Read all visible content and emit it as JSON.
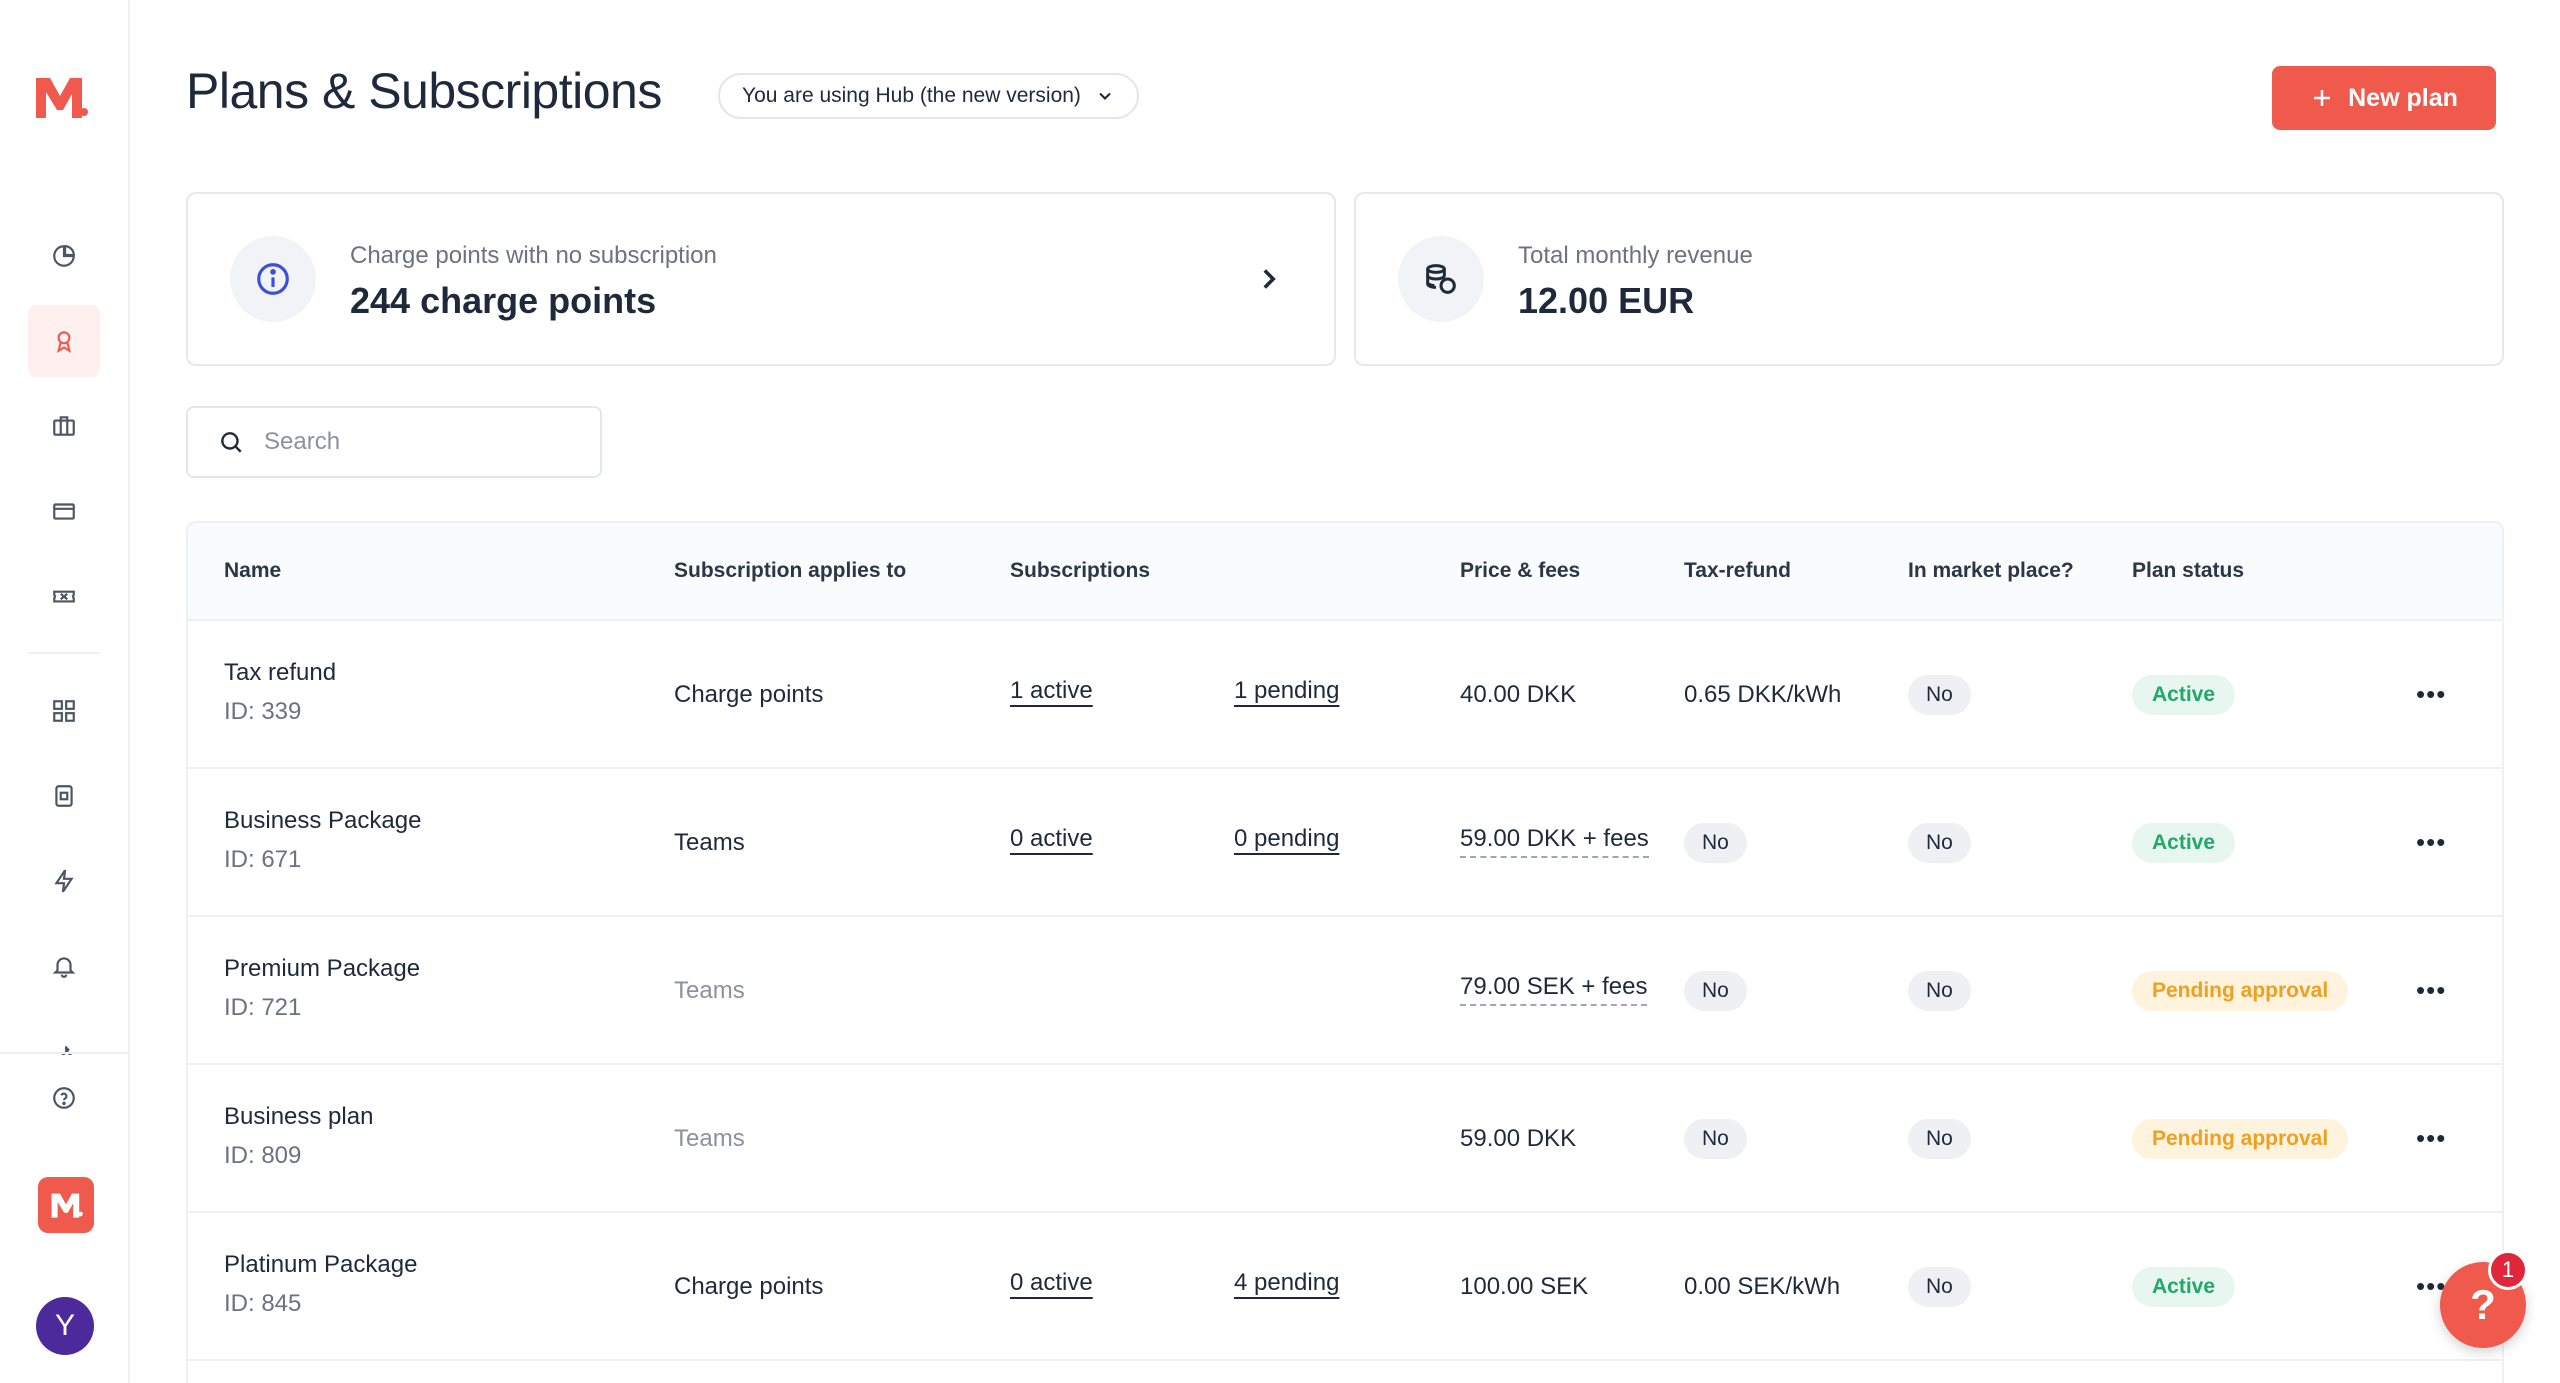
{
  "app": {
    "title": "Plans & Subscriptions",
    "version_label": "You are using Hub (the new version)"
  },
  "header": {
    "new_plan_label": "New plan"
  },
  "cards": {
    "no_subscription": {
      "label": "Charge points with no subscription",
      "value": "244 charge points"
    },
    "revenue": {
      "label": "Total monthly revenue",
      "value": "12.00 EUR"
    }
  },
  "search": {
    "placeholder": "Search",
    "value": ""
  },
  "table": {
    "headers": {
      "name": "Name",
      "applies": "Subscription applies to",
      "subscriptions": "Subscriptions",
      "price": "Price & fees",
      "tax": "Tax-refund",
      "market": "In market place?",
      "status": "Plan status"
    },
    "rows": [
      {
        "name": "Tax refund",
        "id": "ID: 339",
        "applies": "Charge points",
        "active": "1 active",
        "pending": "1 pending",
        "price": "40.00 DKK",
        "tax": "0.65 DKK/kWh",
        "market": "No",
        "status": "Active"
      },
      {
        "name": "Business Package",
        "id": "ID: 671",
        "applies": "Teams",
        "active": "0 active",
        "pending": "0 pending",
        "price": "59.00 DKK + fees",
        "tax": "No",
        "market": "No",
        "status": "Active"
      },
      {
        "name": "Premium Package",
        "id": "ID: 721",
        "applies": "Teams",
        "active": "",
        "pending": "",
        "price": "79.00 SEK + fees",
        "tax": "No",
        "market": "No",
        "status": "Pending approval"
      },
      {
        "name": "Business plan",
        "id": "ID: 809",
        "applies": "Teams",
        "active": "",
        "pending": "",
        "price": "59.00 DKK",
        "tax": "No",
        "market": "No",
        "status": "Pending approval"
      },
      {
        "name": "Platinum Package",
        "id": "ID: 845",
        "applies": "Charge points",
        "active": "0 active",
        "pending": "4 pending",
        "price": "100.00 SEK",
        "tax": "0.00 SEK/kWh",
        "market": "No",
        "status": "Active"
      }
    ]
  },
  "help": {
    "label": "?",
    "badge": "1"
  },
  "user": {
    "avatar_initial": "Y"
  },
  "colors": {
    "accent": "#ef5a4c",
    "active_green": "#22a868",
    "pending_orange": "#f0a020",
    "avatar_purple": "#4c2a9c"
  },
  "icons": {
    "sidebar": [
      "chart-pie-icon",
      "award-icon",
      "briefcase-icon",
      "credit-card-icon",
      "ticket-icon",
      "grid-icon",
      "device-icon",
      "lightning-icon",
      "bell-icon",
      "wrench-icon",
      "help-circle-icon"
    ]
  }
}
